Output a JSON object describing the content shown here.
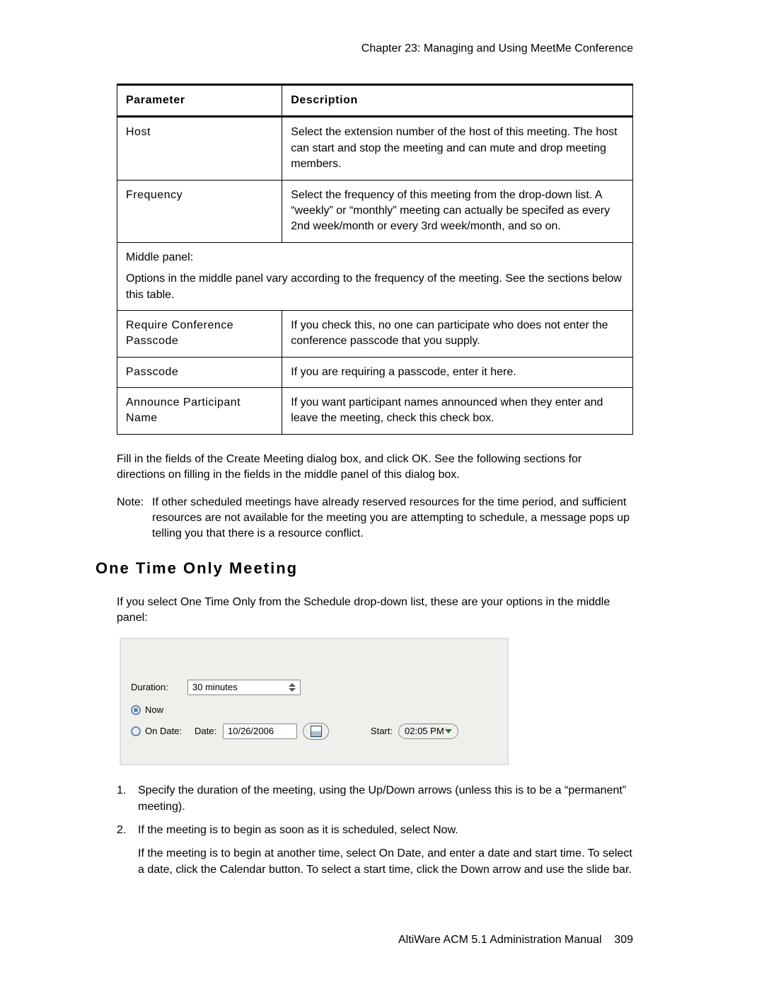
{
  "chapter_header": "Chapter 23:  Managing and Using MeetMe Conference",
  "table": {
    "head_param": "Parameter",
    "head_desc": "Description",
    "rows": [
      {
        "param": "Host",
        "desc": "Select the extension number of the host of this meeting. The host can start and stop the meeting and can mute and drop meeting members."
      },
      {
        "param": "Frequency",
        "desc": "Select the frequency of this meeting from the drop-down list. A “weekly” or “monthly” meeting can actually be specifed as every 2nd week/month or every 3rd week/month, and so on."
      }
    ],
    "middle_note_title": "Middle panel:",
    "middle_note_body": "Options in the middle panel vary according to the frequency of the meeting. See the sections below this table.",
    "rows2": [
      {
        "param": "Require Conference Passcode",
        "desc": "If you check this, no one can participate who does not enter the conference passcode that you supply."
      },
      {
        "param": "Passcode",
        "desc": "If you are requiring a passcode, enter it here."
      },
      {
        "param": "Announce Participant Name",
        "desc": "If you want participant names announced when they enter and leave the meeting, check this check box."
      }
    ]
  },
  "after_table_paragraph": "Fill in the fields of the Create Meeting dialog box, and click OK. See the following sections for directions on filling in the fields in the middle panel of this dialog box.",
  "note_label": "Note:",
  "note_body": "If other scheduled meetings have already reserved resources for the time period, and sufficient resources are not available for the meeting you are attempting to schedule, a message pops up telling you that there is a resource conflict.",
  "subheading": "One Time Only Meeting",
  "subpara": "If you select One Time Only from the Schedule drop-down list, these are your options in the middle panel:",
  "panel": {
    "duration_label": "Duration:",
    "duration_value": "30 minutes",
    "now_label": "Now",
    "on_date_label": "On Date:",
    "date_label": "Date:",
    "date_value": "10/26/2006",
    "start_label": "Start:",
    "start_value": "02:05 PM"
  },
  "steps": {
    "n1": "1.",
    "t1": "Specify the duration of the meeting, using the Up/Down arrows (unless this is to be a “permanent” meeting).",
    "n2": "2.",
    "t2": "If the meeting is to begin as soon as it is scheduled, select Now.",
    "t2b": "If the meeting is to begin at another time, select On Date, and enter a date and start time. To select a date, click the Calendar button. To select a start time, click the Down arrow and use the slide bar."
  },
  "footer_text": "AltiWare ACM 5.1 Administration Manual",
  "footer_page": "309"
}
